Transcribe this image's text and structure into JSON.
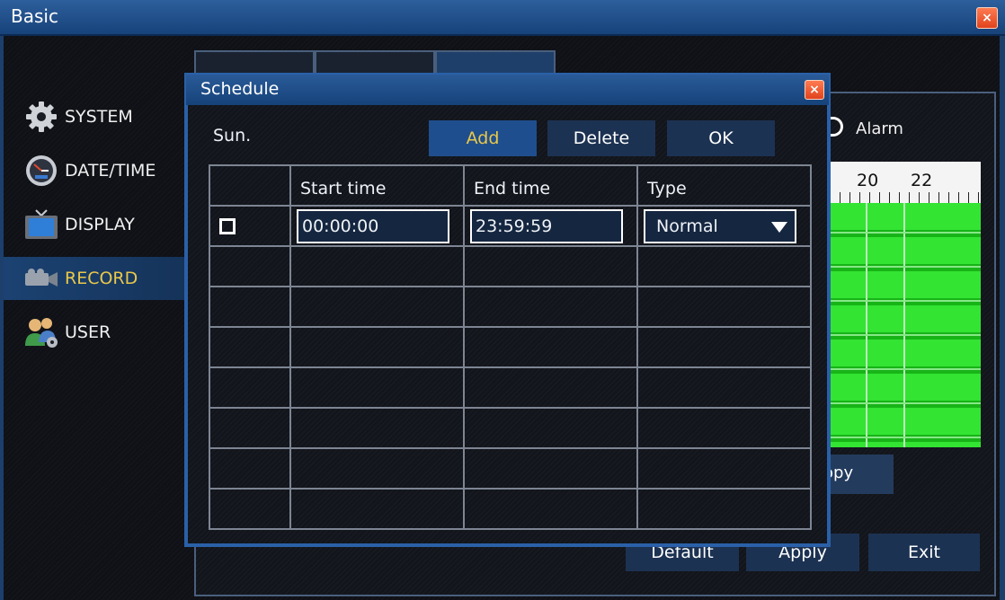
{
  "window": {
    "title": "Basic",
    "close_glyph": "×"
  },
  "sidebar": {
    "items": [
      {
        "label": "SYSTEM",
        "icon": "gear-icon"
      },
      {
        "label": "DATE/TIME",
        "icon": "clock-icon"
      },
      {
        "label": "DISPLAY",
        "icon": "monitor-icon"
      },
      {
        "label": "RECORD",
        "icon": "camera-icon",
        "active": true
      },
      {
        "label": "USER",
        "icon": "users-icon"
      }
    ]
  },
  "background": {
    "alarm_label": "Alarm",
    "timeline_ticks": [
      "20",
      "22"
    ],
    "copy_label": "opy",
    "default_label": "Default",
    "apply_label": "Apply",
    "exit_label": "Exit"
  },
  "dialog": {
    "title": "Schedule",
    "close_glyph": "×",
    "day": "Sun.",
    "add_label": "Add",
    "delete_label": "Delete",
    "ok_label": "OK",
    "columns": [
      "",
      "Start time",
      "End time",
      "Type"
    ],
    "row": {
      "start": "00:00:00",
      "end": "23:59:59",
      "type": "Normal"
    }
  },
  "colors": {
    "title_bar": "#1f4e8e",
    "accent_text": "#e9c84a",
    "timeline_green": "#22d822"
  }
}
